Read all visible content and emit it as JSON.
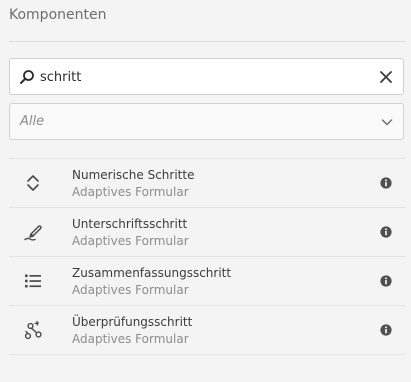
{
  "panel": {
    "title": "Komponenten"
  },
  "search": {
    "value": "schritt",
    "icon": "search-icon",
    "clear_icon": "close-icon"
  },
  "filter": {
    "selected": "Alle",
    "icon": "chevron-down-icon"
  },
  "components": [
    {
      "name": "Numerische Schritte",
      "group": "Adaptives Formular",
      "icon": "numeric-stepper-icon"
    },
    {
      "name": "Unterschriftsschritt",
      "group": "Adaptives Formular",
      "icon": "signature-icon"
    },
    {
      "name": "Zusammenfassungsschritt",
      "group": "Adaptives Formular",
      "icon": "summary-list-icon"
    },
    {
      "name": "Überprüfungsschritt",
      "group": "Adaptives Formular",
      "icon": "verification-icon"
    }
  ],
  "colors": {
    "background": "#f4f4f4",
    "icon": "#4b4b4b",
    "border": "#cfcfcf"
  }
}
